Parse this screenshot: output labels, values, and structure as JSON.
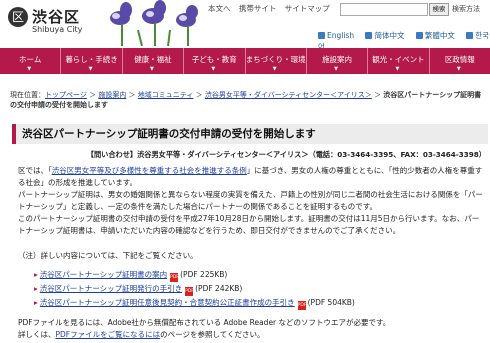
{
  "header": {
    "logo_mark": "区",
    "logo_text": "渋谷区",
    "logo_sub": "Shibuya City",
    "toplinks": [
      "本文へ",
      "携帯サイト",
      "サイトマップ"
    ],
    "search_button": "検索",
    "search_tip": "検索方法",
    "langs": [
      "English",
      "简体中文",
      "繁體中文",
      "한국어"
    ]
  },
  "nav": {
    "items": [
      "ホーム",
      "暮らし・手続き",
      "健康・福祉",
      "子ども・教育",
      "まちづくり・環境",
      "施設案内",
      "観光・イベント",
      "区政情報"
    ]
  },
  "breadcrumb": {
    "label": "現在位置：",
    "items": [
      "トップページ",
      "施設案内",
      "地域コミュニティ",
      "渋谷男女平等・ダイバーシティセンター＜アイリス＞"
    ],
    "current": "渋谷区パートナーシップ証明書の交付申請の受付を開始します"
  },
  "title": "渋谷区パートナーシップ証明書の交付申請の受付を開始します",
  "contact": "【問い合わせ】渋谷男女平等・ダイバーシティセンター＜アイリス＞（電話：03-3464-3395、FAX：03-3464-3398）",
  "paragraph1": {
    "pre": "区では、「",
    "link": "渋谷区男女平等及び多様性を尊重する社会を推進する条例",
    "post": "」に基づき、男女の人権の尊重とともに、「性的少数者の人権を尊重する社会」の形成を推進しています。"
  },
  "paragraph2": "パートナーシップ証明は、男女の婚姻関係と異ならない程度の実質を備えた、戸籍上の性別が同じ二者間の社会生活における関係を「パートナーシップ」と定義し、一定の条件を満たした場合にパートナーの関係であることを証明するものです。",
  "paragraph3": "このパートナーシップ証明書の交付申請の受付を平成27年10月28日から開始します。証明書の交付は11月5日から行います。なお、パートナーシップ証明書は、申請いただいた内容の確認などを行うため、即日交付ができませんのでご了承ください。",
  "note": "（注）詳しい内容については、下記をご覧ください。",
  "pdf_icon_label": "PDF",
  "links": [
    {
      "text": "渋谷区パートナーシップ証明書の案内",
      "size": "(PDF 225KB)"
    },
    {
      "text": "渋谷区パートナーシップ証明発行の手引き",
      "size": "(PDF 242KB)"
    },
    {
      "text": "渋谷区パートナーシップ証明任意後見契約・合意契約公正証書作成の手引き",
      "size": "(PDF 504KB)"
    }
  ],
  "footer1": "PDFファイルを見るには、Adobe社から無償配布されている Adobe Reader などのソフトウエアが必要です。",
  "footer2": {
    "pre": "詳しくは、",
    "link": "PDFファイルをご覧になるには",
    "post": "のページを参照してください。"
  }
}
